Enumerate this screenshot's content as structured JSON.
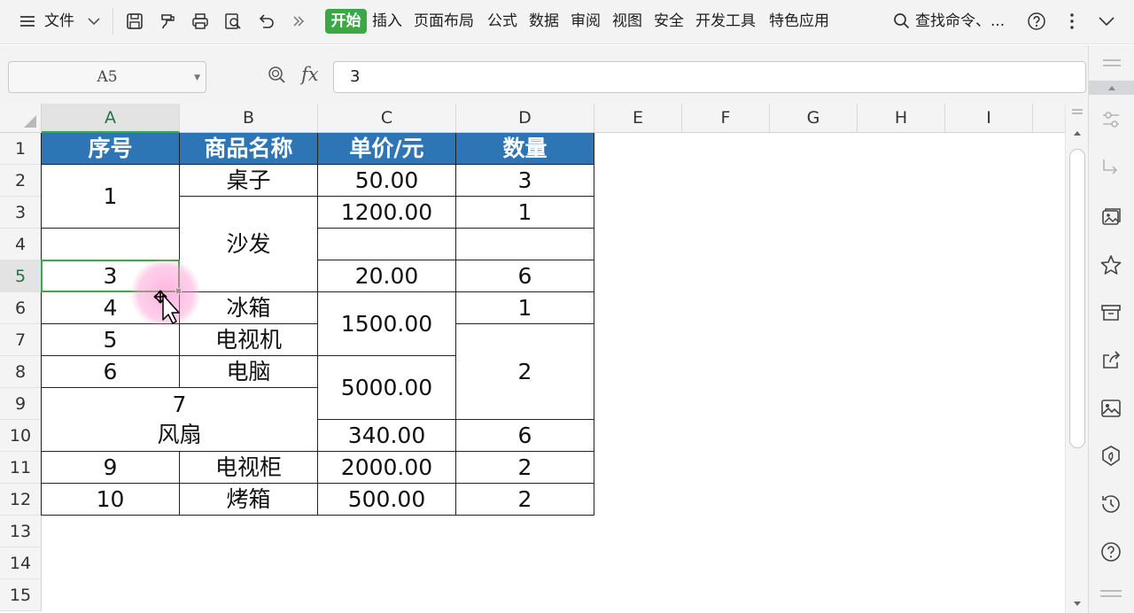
{
  "menubar": {
    "file_label": "文件",
    "tabs": [
      "开始",
      "插入",
      "页面布局",
      "公式",
      "数据",
      "审阅",
      "视图",
      "安全",
      "开发工具",
      "特色应用"
    ],
    "search_label": "查找命令、..."
  },
  "formula_bar": {
    "name_box": "A5",
    "fx_label": "fx",
    "value": "3"
  },
  "columns": [
    "A",
    "B",
    "C",
    "D",
    "E",
    "F",
    "G",
    "H",
    "I"
  ],
  "rows": [
    "1",
    "2",
    "3",
    "4",
    "5",
    "6",
    "7",
    "8",
    "9",
    "10",
    "11",
    "12",
    "13",
    "14",
    "15"
  ],
  "table": {
    "headers": [
      "序号",
      "商品名称",
      "单价/元",
      "数量"
    ],
    "a2": "1",
    "a5": "3",
    "a6": "4",
    "a7": "5",
    "a8": "6",
    "a9_line1": "7",
    "a9_line2": "风扇",
    "a11": "9",
    "a12": "10",
    "b2": "桌子",
    "b3": "沙发",
    "b6": "冰箱",
    "b7": "电视机",
    "b8": "电脑",
    "b11": "电视柜",
    "b12": "烤箱",
    "c2": "50.00",
    "c3": "1200.00",
    "c5": "20.00",
    "c6": "1500.00",
    "c8": "5000.00",
    "c10": "340.00",
    "c11": "2000.00",
    "c12": "500.00",
    "d2": "3",
    "d3": "1",
    "d5": "6",
    "d6": "1",
    "d7": "2",
    "d10": "6",
    "d11": "2",
    "d12": "2"
  },
  "colors": {
    "header_fill": "#2e75b6",
    "accent_green": "#3aa847"
  }
}
